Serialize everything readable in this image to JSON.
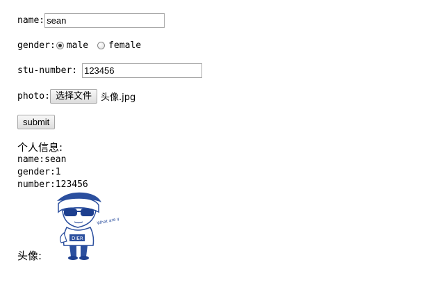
{
  "form": {
    "name_label": "name:",
    "name_value": "sean",
    "gender_label": "gender:",
    "gender_options": [
      {
        "label": "male",
        "checked": true
      },
      {
        "label": "female",
        "checked": false
      }
    ],
    "stu_number_label": "stu-number:",
    "stu_number_value": "123456",
    "photo_label": "photo:",
    "file_button_label": "选择文件",
    "file_name": "头像.jpg",
    "submit_label": "submit"
  },
  "info": {
    "heading": "个人信息:",
    "name_line": "name:sean",
    "gender_line": "gender:1",
    "number_line": "number:123456",
    "avatar_label": "头像:",
    "avatar_caption": "What are you doing?",
    "avatar_shirt_text": "DIER"
  }
}
